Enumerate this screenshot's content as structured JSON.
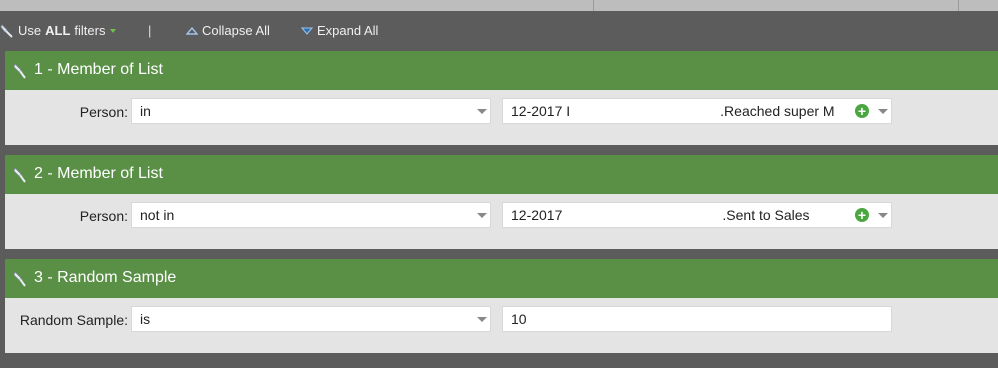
{
  "toolbar": {
    "use_filters_prefix": "Use",
    "use_filters_strong": "ALL",
    "use_filters_suffix": "filters",
    "separator": "|",
    "collapse_all": "Collapse All",
    "expand_all": "Expand All"
  },
  "filters": [
    {
      "title": "1 - Member of List",
      "label": "Person:",
      "operator": "in",
      "value_prefix": "12-2017 I",
      "value_suffix": ".Reached super M"
    },
    {
      "title": "2 - Member of List",
      "label": "Person:",
      "operator": "not in",
      "value_prefix": "12-2017",
      "value_suffix": ".Sent to Sales"
    },
    {
      "title": "3 - Random Sample",
      "label": "Random Sample:",
      "operator": "is",
      "value": "10"
    }
  ],
  "colors": {
    "header_green": "#5a8f46",
    "plus_green": "#4aa63f",
    "background_gray": "#5c5c5c",
    "panel_gray": "#e4e4e4"
  },
  "icons": [
    "filter-wrench-icon",
    "caret-down-icon",
    "triangle-up-icon",
    "triangle-down-icon",
    "add-plus-icon"
  ]
}
